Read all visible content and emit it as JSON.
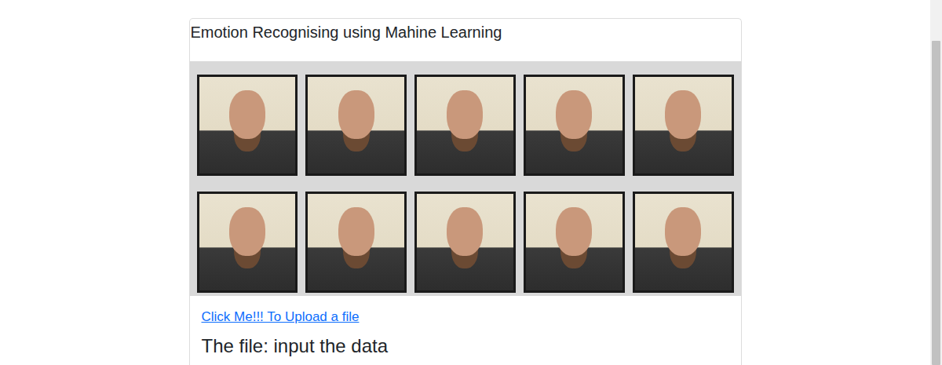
{
  "page": {
    "title": "Emotion Recognising using Mahine Learning"
  },
  "upload_link": "Click Me!!! To Upload a file",
  "file_heading": "The file: input the data"
}
